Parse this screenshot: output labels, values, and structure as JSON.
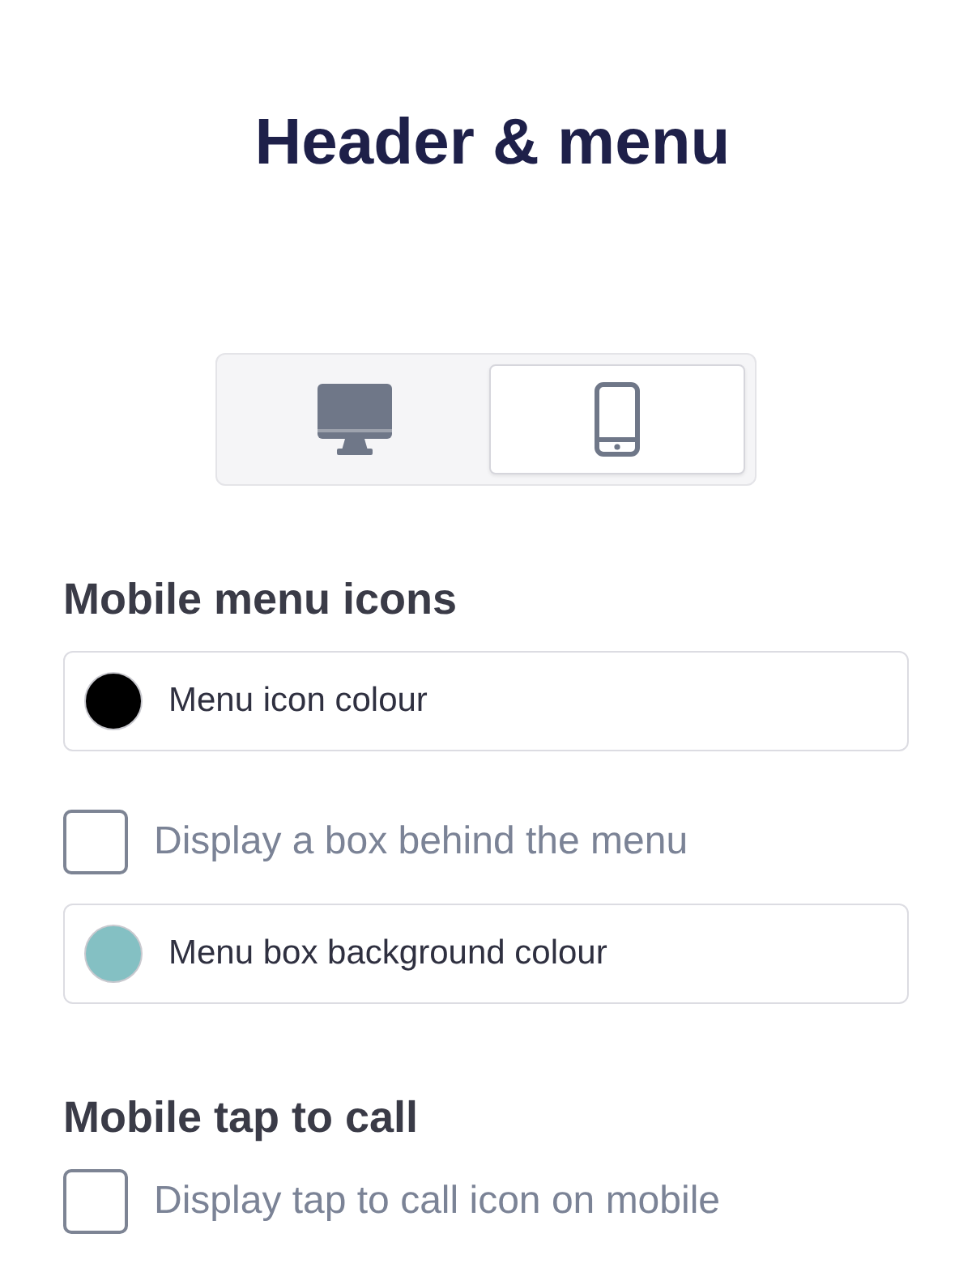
{
  "title": "Header & menu",
  "device_tabs": [
    {
      "kind": "desktop",
      "selected": false
    },
    {
      "kind": "mobile",
      "selected": true
    }
  ],
  "sections": [
    {
      "heading": "Mobile menu icons",
      "items": [
        {
          "kind": "color",
          "label": "Menu icon colour",
          "color": "#000000"
        },
        {
          "kind": "checkbox",
          "label": "Display a box behind the menu",
          "checked": false
        },
        {
          "kind": "color",
          "label": "Menu box background colour",
          "color": "#84c0c3"
        }
      ]
    },
    {
      "heading": "Mobile tap to call",
      "items": [
        {
          "kind": "checkbox",
          "label": "Display tap to call icon on mobile",
          "checked": false
        }
      ]
    }
  ]
}
